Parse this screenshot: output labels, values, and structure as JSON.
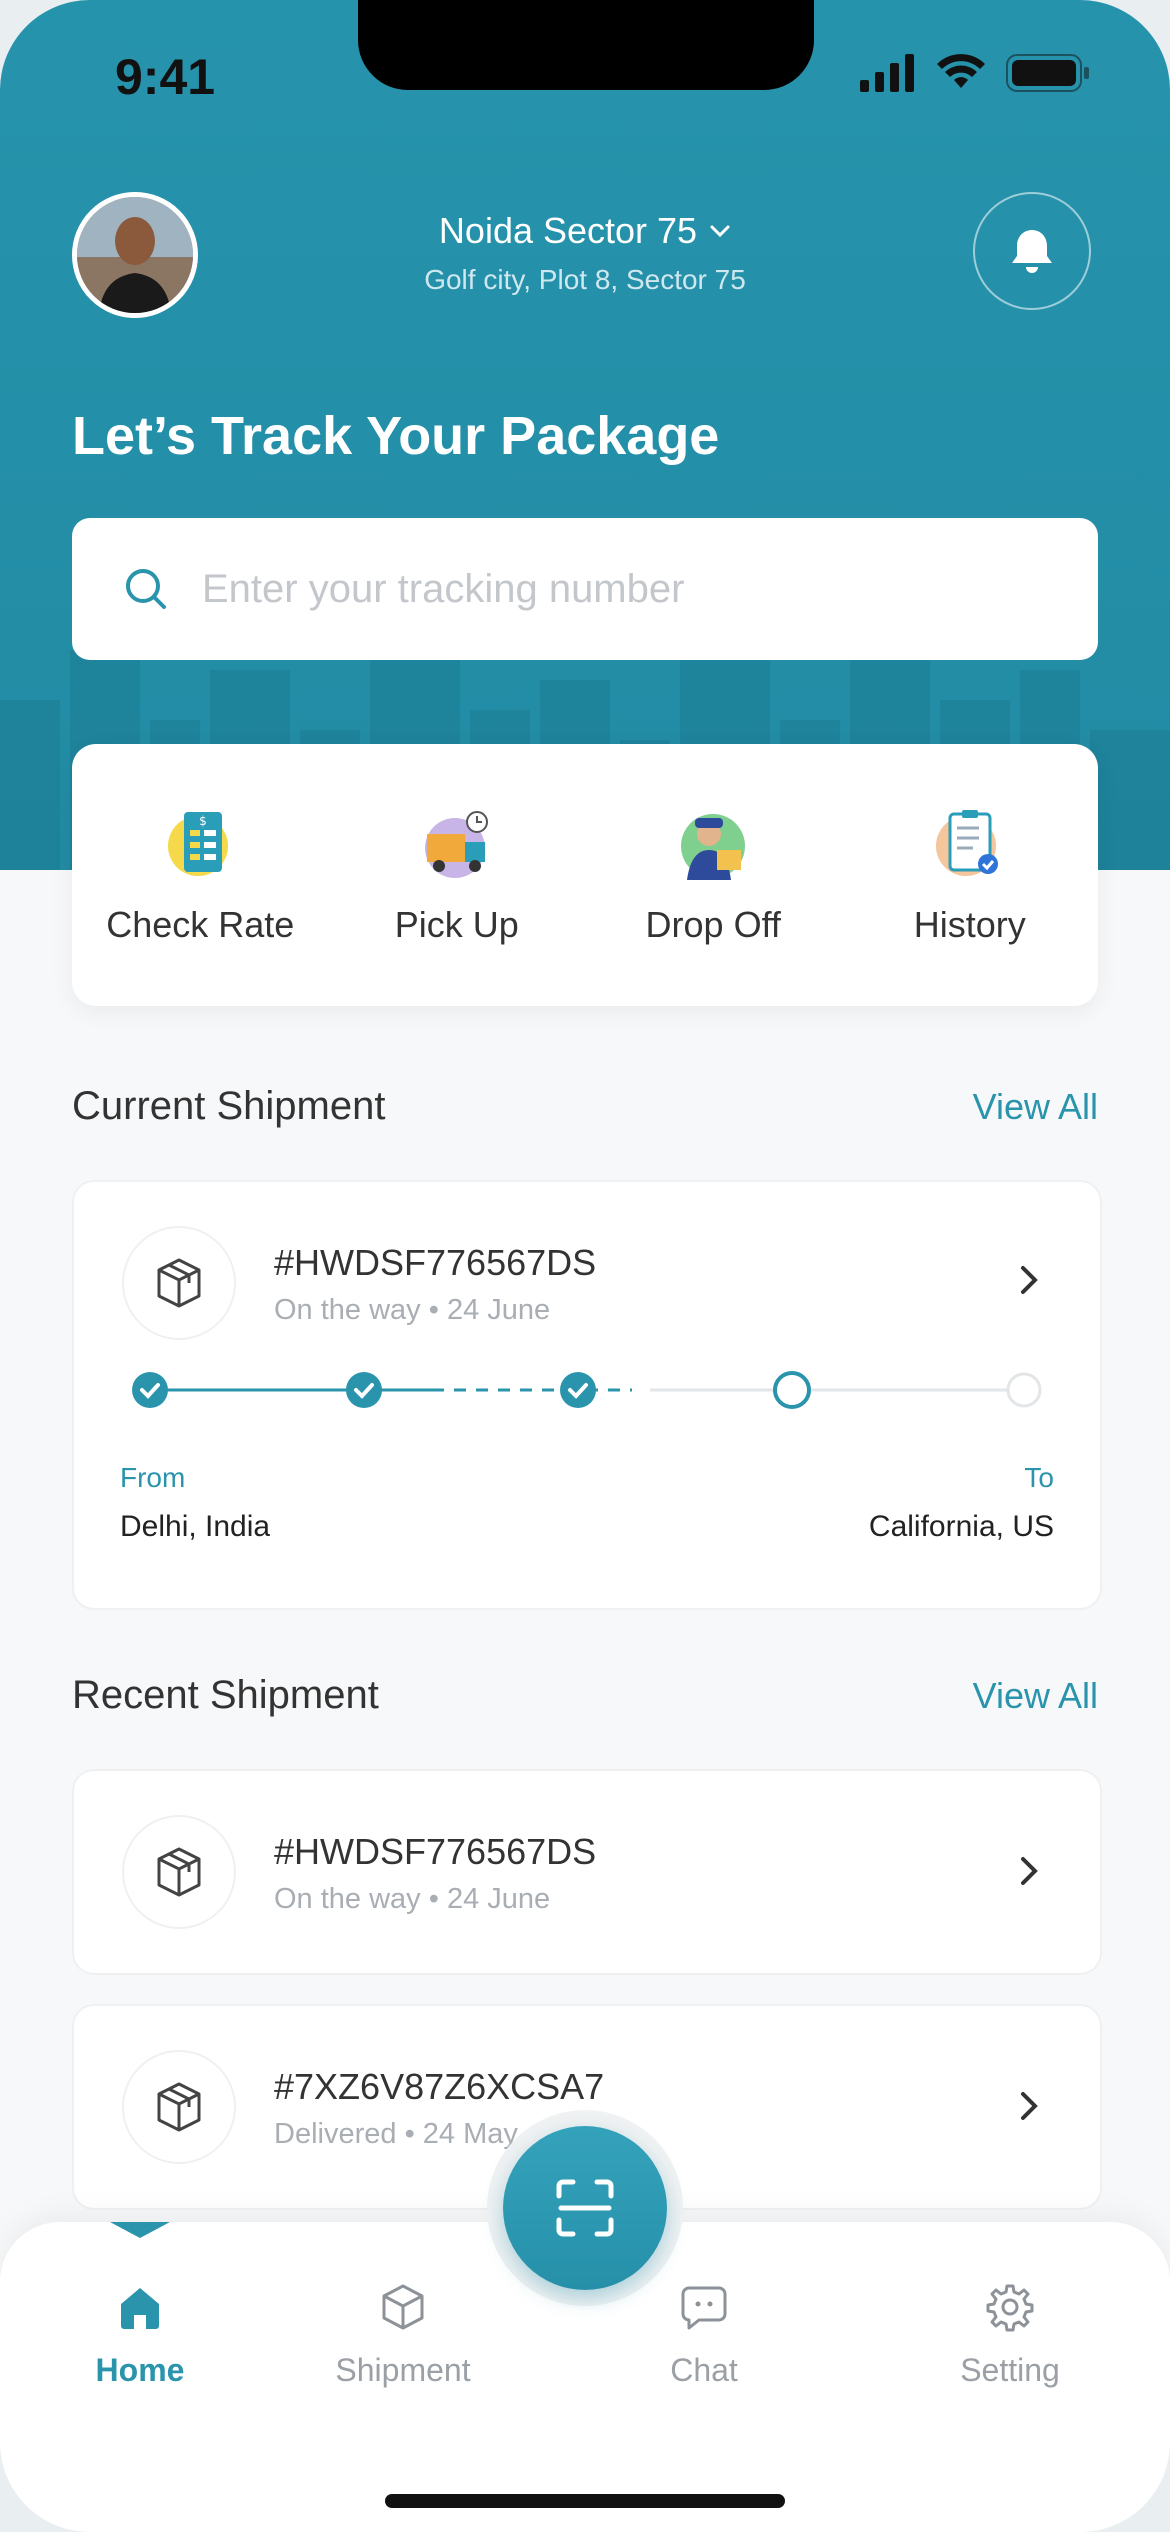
{
  "status_bar": {
    "time": "9:41"
  },
  "header": {
    "location_title": "Noida Sector 75",
    "location_address": "Golf city, Plot 8, Sector 75"
  },
  "headline": "Let’s Track Your Package",
  "search": {
    "placeholder": "Enter your tracking number",
    "value": ""
  },
  "quick_actions": [
    {
      "label": "Check Rate",
      "icon": "check-rate-icon"
    },
    {
      "label": "Pick Up",
      "icon": "pick-up-icon"
    },
    {
      "label": "Drop Off",
      "icon": "drop-off-icon"
    },
    {
      "label": "History",
      "icon": "history-icon"
    }
  ],
  "current_shipment": {
    "title": "Current Shipment",
    "view_all": "View All",
    "item": {
      "id": "#HWDSF776567DS",
      "status": "On the way",
      "date": "24 June",
      "from_label": "From",
      "from": "Delhi, India",
      "to_label": "To",
      "to": "California, US",
      "progress_steps_completed": 3,
      "progress_steps_total": 5
    }
  },
  "recent_shipment": {
    "title": "Recent Shipment",
    "view_all": "View All",
    "items": [
      {
        "id": "#HWDSF776567DS",
        "status": "On the way",
        "date": "24 June"
      },
      {
        "id": "#7XZ6V87Z6XCSA7",
        "status": "Delivered",
        "date": "24 May"
      }
    ]
  },
  "bottom_nav": {
    "items": [
      {
        "label": "Home",
        "active": true
      },
      {
        "label": "Shipment",
        "active": false
      },
      {
        "label": "Chat",
        "active": false
      },
      {
        "label": "Setting",
        "active": false
      }
    ],
    "fab_icon": "scan-icon"
  },
  "colors": {
    "primary": "#2693ac",
    "accent_text": "#2a94ad",
    "background": "#f7f8f9"
  }
}
